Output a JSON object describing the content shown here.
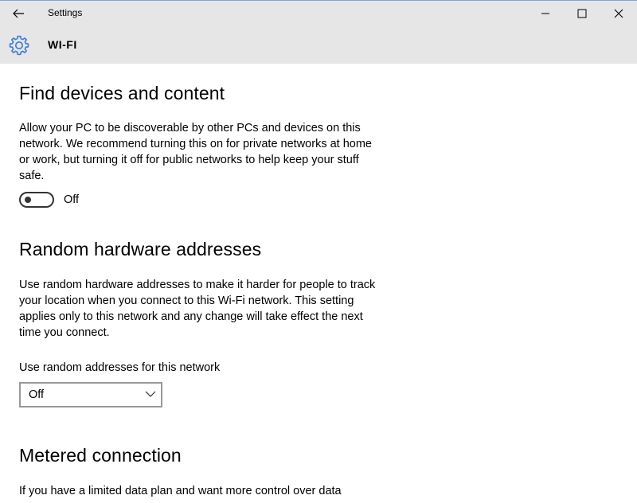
{
  "window": {
    "title": "Settings"
  },
  "header": {
    "title": "WI-FI",
    "icon": "gear-icon",
    "accent_color": "#3a7bd5"
  },
  "sections": [
    {
      "title": "Find devices and content",
      "description": "Allow your PC to be discoverable by other PCs and devices on this network. We recommend turning this on for private networks at home or work, but turning it off for public networks to help keep your stuff safe.",
      "toggle": {
        "state": "Off",
        "on": false
      }
    },
    {
      "title": "Random hardware addresses",
      "description": "Use random hardware addresses to make it harder for people to track your location when you connect to this Wi-Fi network. This setting applies only to this network and any change will take effect the next time you connect.",
      "select_label": "Use random addresses for this network",
      "select_value": "Off"
    },
    {
      "title": "Metered connection",
      "description": "If you have a limited data plan and want more control over data"
    }
  ]
}
